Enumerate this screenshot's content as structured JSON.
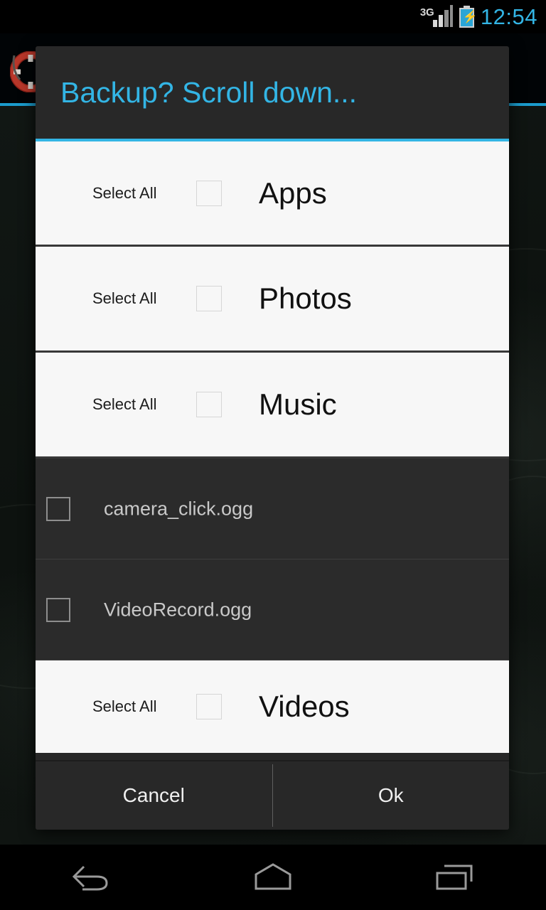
{
  "status_bar": {
    "network_label": "3G",
    "signal_icon": "signal-bars-icon",
    "battery_icon": "battery-charging-icon",
    "clock": "12:54",
    "accent_color": "#33b5e5"
  },
  "background_app": {
    "icon": "lifebuoy-icon",
    "accent_color": "#1b9ccd"
  },
  "dialog": {
    "title": "Backup? Scroll down...",
    "title_color": "#33b5e5",
    "select_all_label": "Select All",
    "groups": [
      {
        "title": "Apps",
        "select_all": "Select All",
        "checked": false
      },
      {
        "title": "Photos",
        "select_all": "Select All",
        "checked": false
      },
      {
        "title": "Music",
        "select_all": "Select All",
        "checked": false
      },
      {
        "title": "Videos",
        "select_all": "Select All",
        "checked": false
      }
    ],
    "files": [
      {
        "name": "camera_click.ogg",
        "checked": false
      },
      {
        "name": "VideoRecord.ogg",
        "checked": false
      }
    ],
    "buttons": {
      "cancel": "Cancel",
      "ok": "Ok"
    }
  },
  "nav_bar": {
    "back": "back-icon",
    "home": "home-icon",
    "recents": "recents-icon"
  }
}
